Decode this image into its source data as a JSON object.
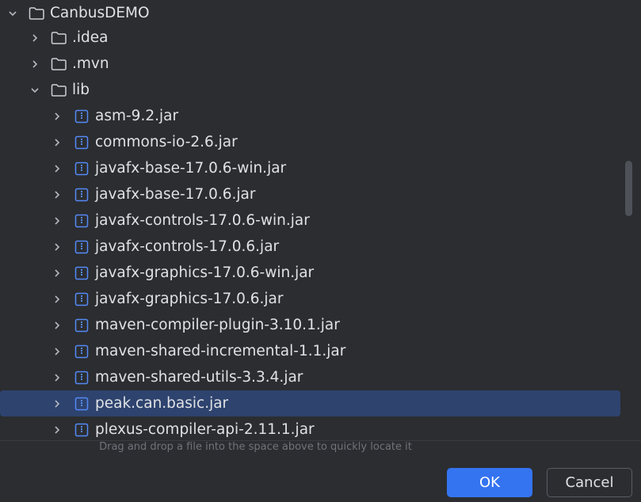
{
  "tree": [
    {
      "label": "CanbusDEMO",
      "expanded": true,
      "icon": "folder-icon"
    },
    {
      "label": ".idea",
      "expanded": false,
      "icon": "folder-icon"
    },
    {
      "label": ".mvn",
      "expanded": false,
      "icon": "folder-icon"
    },
    {
      "label": "lib",
      "expanded": true,
      "icon": "folder-icon"
    },
    {
      "label": "asm-9.2.jar",
      "icon": "jar-icon"
    },
    {
      "label": "commons-io-2.6.jar",
      "icon": "jar-icon"
    },
    {
      "label": "javafx-base-17.0.6-win.jar",
      "icon": "jar-icon"
    },
    {
      "label": "javafx-base-17.0.6.jar",
      "icon": "jar-icon"
    },
    {
      "label": "javafx-controls-17.0.6-win.jar",
      "icon": "jar-icon"
    },
    {
      "label": "javafx-controls-17.0.6.jar",
      "icon": "jar-icon"
    },
    {
      "label": "javafx-graphics-17.0.6-win.jar",
      "icon": "jar-icon"
    },
    {
      "label": "javafx-graphics-17.0.6.jar",
      "icon": "jar-icon"
    },
    {
      "label": "maven-compiler-plugin-3.10.1.jar",
      "icon": "jar-icon"
    },
    {
      "label": "maven-shared-incremental-1.1.jar",
      "icon": "jar-icon"
    },
    {
      "label": "maven-shared-utils-3.3.4.jar",
      "icon": "jar-icon"
    },
    {
      "label": "peak.can.basic.jar",
      "icon": "jar-icon",
      "selected": true
    },
    {
      "label": "plexus-compiler-api-2.11.1.jar",
      "icon": "jar-icon"
    }
  ],
  "hint": "Drag and drop a file into the space above to quickly locate it",
  "buttons": {
    "ok": "OK",
    "cancel": "Cancel"
  },
  "colors": {
    "background": "#2b2d30",
    "selection": "#2e436e",
    "accent": "#3574f0",
    "jar_icon": "#548af7"
  }
}
